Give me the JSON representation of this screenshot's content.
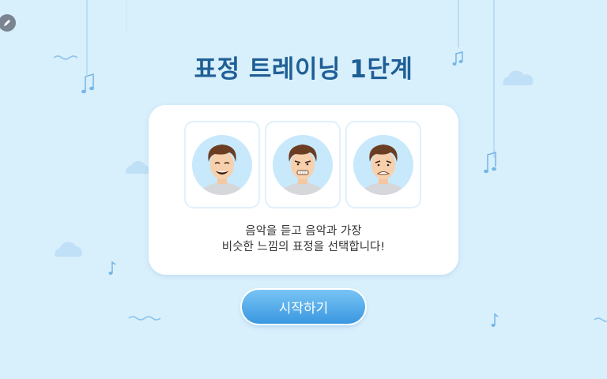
{
  "title": "표정 트레이닝 1단계",
  "instruction_line1": "음악을 듣고 음악과 가장",
  "instruction_line2": "비슷한 느낌의 표정을 선택합니다!",
  "start_button": "시작하기",
  "faces": [
    {
      "expression": "smiling"
    },
    {
      "expression": "clenched-teeth"
    },
    {
      "expression": "sad"
    }
  ],
  "colors": {
    "background": "#d8effc",
    "title": "#1f5f96",
    "button_top": "#78c4f4",
    "button_bottom": "#3a97e0"
  }
}
